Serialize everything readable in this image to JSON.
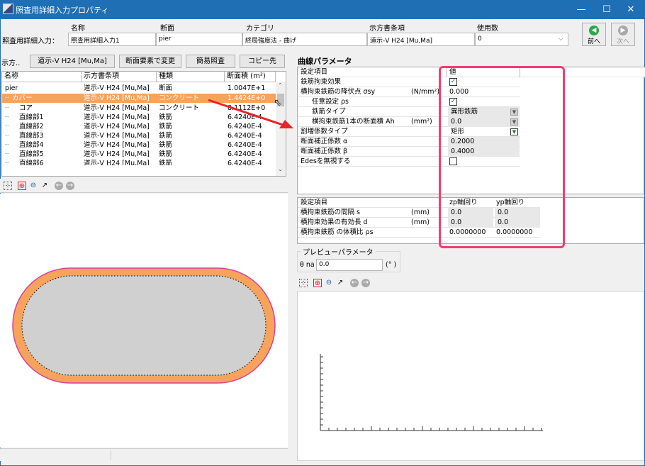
{
  "window": {
    "title": "照査用詳細入力プロパティ",
    "min": "—",
    "max": "☐",
    "close": "✕"
  },
  "header": {
    "row_label": "照査用詳細入力：",
    "col_name": "名称",
    "col_section": "断面",
    "col_category": "カテゴリ",
    "col_spec": "示方書条項",
    "col_usage": "使用数",
    "name_value": "照査用詳細入力1",
    "section_value": "pier",
    "category_value": "終局強度法 - 曲げ",
    "spec_value": "道示-V H24 [Mu,Ma]",
    "usage_value": "0",
    "prev_label": "前へ",
    "next_label": "次へ"
  },
  "left_toolbar": {
    "spec_label": "示方..",
    "spec_value": "道示-V H24 [Mu,Ma]",
    "change_btn": "断面要素で変更",
    "simple_btn": "簡易照査",
    "copy_btn": "コピー先"
  },
  "element_grid": {
    "headers": [
      "名称",
      "示方書条項",
      "種類",
      "断面積 (m²)"
    ],
    "rows": [
      {
        "name": "pier",
        "spec": "道示-V H24 [Mu,Ma]",
        "type": "断面",
        "area": "1.0047E+1"
      },
      {
        "name": "カバー",
        "spec": "道示-V H24 [Mu,Ma]",
        "type": "コンクリート",
        "area": "1.4424E+0"
      },
      {
        "name": "コア",
        "spec": "道示-V H24 [Mu,Ma]",
        "type": "コンクリート",
        "area": "8.1112E+0"
      },
      {
        "name": "直線部1",
        "spec": "道示-V H24 [Mu,Ma]",
        "type": "鉄筋",
        "area": "6.4240E-4"
      },
      {
        "name": "直線部2",
        "spec": "道示-V H24 [Mu,Ma]",
        "type": "鉄筋",
        "area": "6.4240E-4"
      },
      {
        "name": "直線部3",
        "spec": "道示-V H24 [Mu,Ma]",
        "type": "鉄筋",
        "area": "6.4240E-4"
      },
      {
        "name": "直線部4",
        "spec": "道示-V H24 [Mu,Ma]",
        "type": "鉄筋",
        "area": "6.4240E-4"
      },
      {
        "name": "直線部5",
        "spec": "道示-V H24 [Mu,Ma]",
        "type": "鉄筋",
        "area": "6.4240E-4"
      },
      {
        "name": "直線部6",
        "spec": "道示-V H24 [Mu,Ma]",
        "type": "鉄筋",
        "area": "6.4240E-4"
      }
    ]
  },
  "curve_params": {
    "title": "曲線パラメータ",
    "headers": [
      "設定項目",
      "値"
    ],
    "rows": [
      {
        "label": "鉄筋拘束効果",
        "unit": "",
        "value": "",
        "check": "✓"
      },
      {
        "label": "横拘束鉄筋の降伏点 σsy",
        "unit": "(N/mm²)",
        "value": "0.000",
        "check": ""
      },
      {
        "label": "任意設定 ρs",
        "unit": "",
        "value": "",
        "check": "✓"
      },
      {
        "label": "鉄筋タイプ",
        "unit": "",
        "value": "異形鉄筋",
        "check": ""
      },
      {
        "label": "横拘束鉄筋1本の断面積 Ah",
        "unit": "(mm²)",
        "value": "0.0",
        "check": ""
      },
      {
        "label": "割増係数タイプ",
        "unit": "",
        "value": "矩形",
        "check": ""
      },
      {
        "label": "断面補正係数 α",
        "unit": "",
        "value": "0.2000",
        "check": ""
      },
      {
        "label": "断面補正係数 β",
        "unit": "",
        "value": "0.4000",
        "check": ""
      },
      {
        "label": "Edesを無視する",
        "unit": "",
        "value": "",
        "check": " "
      }
    ]
  },
  "axis_params": {
    "headers": [
      "設定項目",
      "zp軸回り",
      "yp軸回り"
    ],
    "rows": [
      {
        "label": "横拘束鉄筋の間隔 s",
        "unit": "(mm)",
        "zp": "0.0",
        "yp": "0.0"
      },
      {
        "label": "横拘束効果の有効長 d",
        "unit": "(mm)",
        "zp": "0.0",
        "yp": "0.0"
      },
      {
        "label": "横拘束鉄筋 の体積比 ρs",
        "unit": "",
        "zp": "0.0000000",
        "yp": "0.0000000"
      }
    ]
  },
  "preview_params": {
    "title": "プレビューパラメータ",
    "theta_label": "θ na",
    "theta_value": "0.0",
    "theta_unit": "(° )"
  },
  "colors": {
    "titlebar": "#1f6fb5",
    "selection": "#f7a35c",
    "highlight_box": "#ef3f73",
    "arrow": "#e8232a"
  }
}
